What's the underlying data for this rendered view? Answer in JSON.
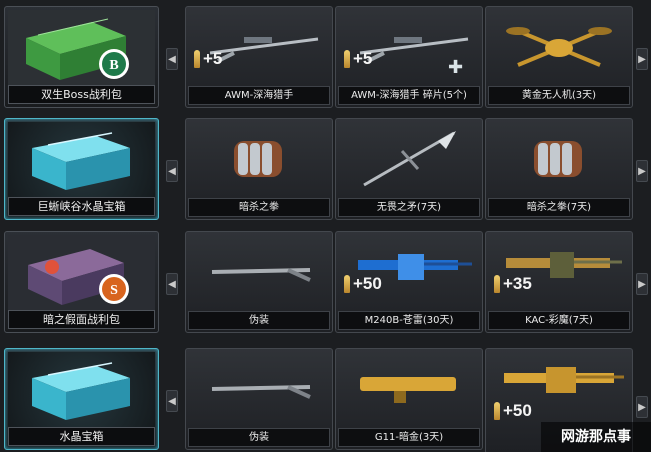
{
  "colors": {
    "accent_blue": "#4fb6c9",
    "gold": "#d9a637",
    "badge_green": "#1e7a4a",
    "badge_orange": "#d8641e"
  },
  "rows": [
    {
      "chest": {
        "label": "双生Boss战利包",
        "badge": "B",
        "style": "dark"
      },
      "items": [
        {
          "label": "",
          "bonus": "+5",
          "art": "bonus-ammo"
        },
        {
          "label": "AWM-深海猎手",
          "bonus": "+5",
          "art": "sniper-rifle"
        },
        {
          "label": "AWM-深海猎手 碎片(5个)",
          "bonus": "",
          "art": "sniper-fragment"
        },
        {
          "label": "黄金无人机(3天)",
          "bonus": "",
          "art": "gold-drone"
        }
      ]
    },
    {
      "chest": {
        "label": "巨蜥峡谷水晶宝箱",
        "badge": "",
        "style": "blue"
      },
      "items": [
        {
          "label": "暗杀之拳",
          "bonus": "",
          "art": "fist-glove"
        },
        {
          "label": "无畏之矛(7天)",
          "bonus": "",
          "art": "spear"
        },
        {
          "label": "暗杀之拳(7天)",
          "bonus": "",
          "art": "fist-glove"
        }
      ]
    },
    {
      "chest": {
        "label": "暗之假面战利包",
        "badge": "S",
        "style": "dark"
      },
      "items": [
        {
          "label": "伪装",
          "bonus": "",
          "art": "disguise-rifle"
        },
        {
          "label": "M240B-苍雷(30天)",
          "bonus": "+50",
          "art": "blue-mg"
        },
        {
          "label": "KAC-彩魔(7天)",
          "bonus": "+35",
          "art": "color-mg"
        }
      ]
    },
    {
      "chest": {
        "label": "水晶宝箱",
        "badge": "",
        "style": "blue"
      },
      "items": [
        {
          "label": "伪装",
          "bonus": "",
          "art": "disguise-rifle"
        },
        {
          "label": "G11-暗金(3天)",
          "bonus": "",
          "art": "gold-rifle"
        },
        {
          "label": "",
          "bonus": "+50",
          "art": "gold-mg"
        }
      ]
    }
  ],
  "watermark": "网游那点事",
  "icons": {
    "left": "chevron-left-icon",
    "right": "chevron-right-icon",
    "fragment": "puzzle-fragment-icon"
  }
}
